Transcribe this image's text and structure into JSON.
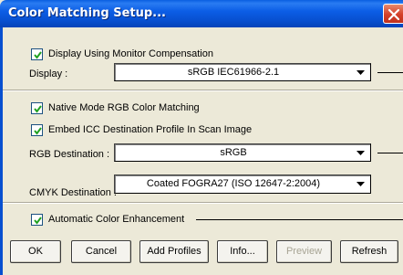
{
  "window": {
    "title": "Color Matching Setup..."
  },
  "monitor": {
    "compensation_label": "Display Using Monitor Compensation",
    "compensation_checked": true,
    "display_label": "Display :",
    "display_value": "sRGB IEC61966-2.1"
  },
  "matching": {
    "native_label": "Native Mode RGB Color Matching",
    "native_checked": true,
    "embed_label": "Embed ICC Destination Profile In Scan Image",
    "embed_checked": true,
    "rgb_label": "RGB Destination :",
    "rgb_value": "sRGB",
    "cmyk_label": "CMYK Destination :",
    "cmyk_value": "Coated FOGRA27 (ISO 12647-2:2004)"
  },
  "enhancement": {
    "auto_label": "Automatic Color Enhancement",
    "auto_checked": true
  },
  "buttons": {
    "ok": "OK",
    "cancel": "Cancel",
    "add_profiles": "Add Profiles",
    "info": "Info...",
    "preview": "Preview",
    "refresh": "Refresh"
  }
}
